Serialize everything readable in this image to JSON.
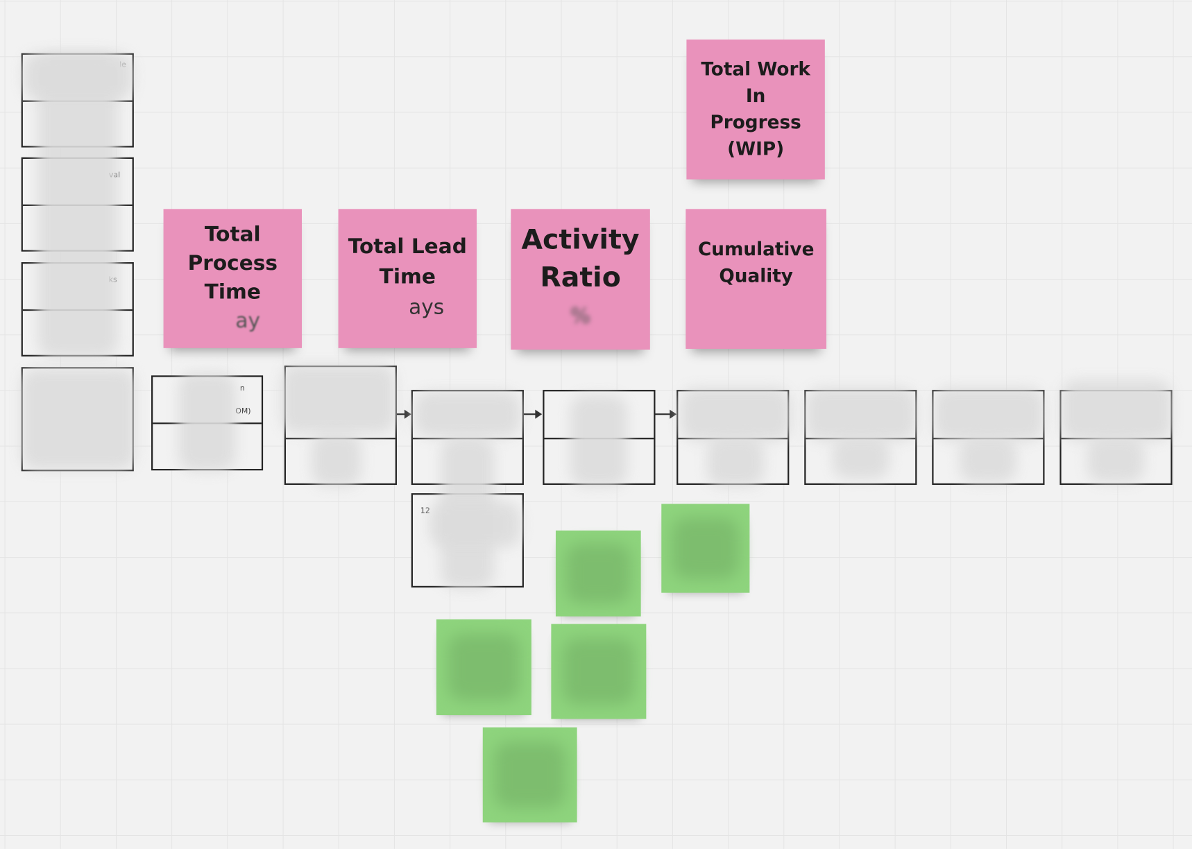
{
  "metrics": {
    "wip": {
      "title": "Total Work In Progress (WIP)",
      "value": ""
    },
    "process_time": {
      "title": "Total Process Time",
      "value": "ay"
    },
    "lead_time": {
      "title": "Total Lead Time",
      "value": "ays"
    },
    "activity_ratio": {
      "title": "Activity Ratio",
      "value": "%"
    },
    "cumulative_quality": {
      "title": "Cumulative Quality",
      "value": ""
    }
  },
  "fragments": {
    "box1": "le",
    "box2": "val",
    "box3": "ks",
    "row1a": "n",
    "row1b": "OM)",
    "under": "12"
  },
  "colors": {
    "metric_sticky": "#e992bb",
    "idea_sticky": "#8ed47d",
    "canvas": "#f2f2f2"
  }
}
